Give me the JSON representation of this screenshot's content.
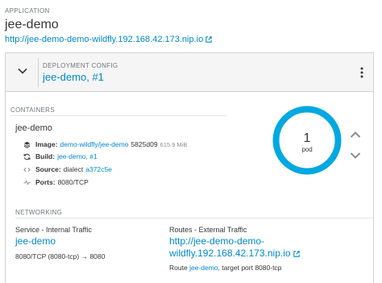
{
  "application": {
    "label": "APPLICATION",
    "name": "jee-demo",
    "route_url": "http://jee-demo-demo-wildfly.192.168.42.173.nip.io"
  },
  "deployment_config": {
    "label": "DEPLOYMENT CONFIG",
    "name": "jee-demo, #1"
  },
  "containers": {
    "label": "CONTAINERS",
    "name": "jee-demo",
    "image_label": "Image:",
    "image_link": "demo-wildfly/jee-demo",
    "image_hash": "5825d09",
    "image_size": "615.9 MiB",
    "build_label": "Build:",
    "build_link": "jee-demo, #1",
    "source_label": "Source:",
    "source_text": "dialect",
    "source_commit": "a372c5e",
    "ports_label": "Ports:",
    "ports_value": "8080/TCP"
  },
  "pods": {
    "count": "1",
    "label": "pod",
    "ring_color": "#00a8e1"
  },
  "networking": {
    "label": "NETWORKING",
    "service_heading": "Service - Internal Traffic",
    "service_name": "jee-demo",
    "service_port": "8080/TCP (8080-tcp) → 8080",
    "routes_heading": "Routes - External Traffic",
    "route_url": "http://jee-demo-demo-wildfly.192.168.42.173.nip.io",
    "route_prefix": "Route",
    "route_link": "jee-demo",
    "route_suffix": ", target port 8080-tcp"
  },
  "icons": {
    "external_link": "external-link-icon",
    "collapse": "chevron-down-icon",
    "menu": "kebab-icon",
    "image": "layers-icon",
    "build": "refresh-icon",
    "source": "code-icon",
    "ports": "pulse-icon",
    "scale_up": "chevron-up-icon",
    "scale_down": "chevron-down-icon"
  }
}
